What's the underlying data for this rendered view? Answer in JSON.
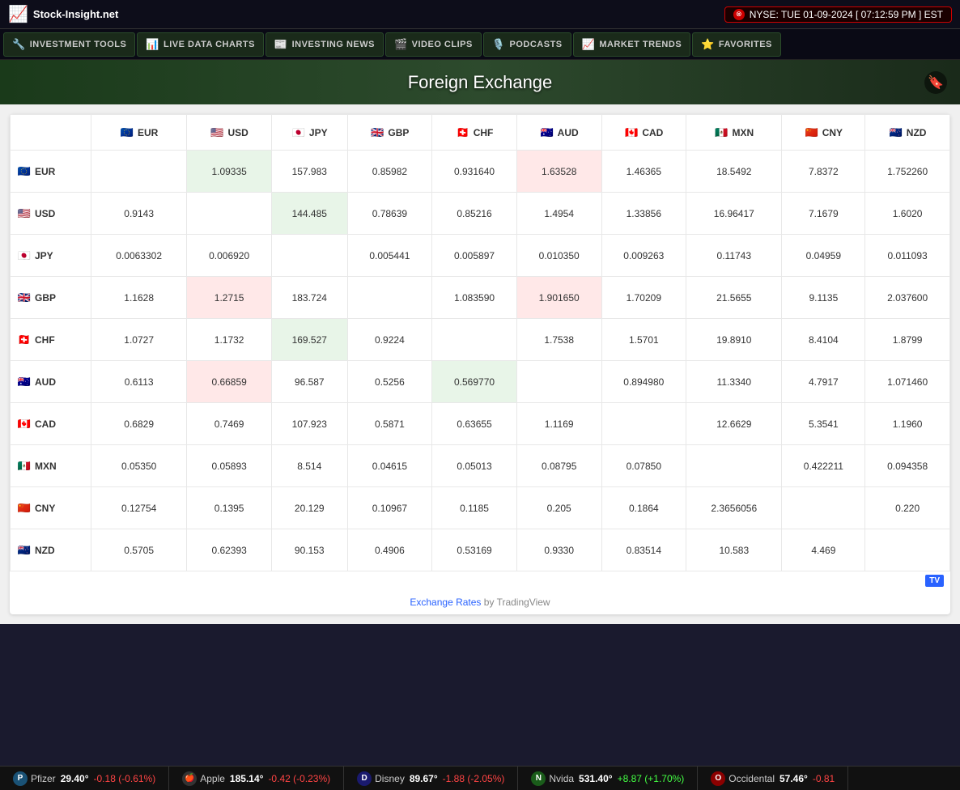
{
  "topbar": {
    "logo_icon": "📈",
    "logo_text": "Stock-Insight.net",
    "ticker_info": "NYSE: TUE 01-09-2024  [ 07:12:59 PM ] EST"
  },
  "nav": {
    "items": [
      {
        "id": "investment-tools",
        "label": "INVESTMENT TOOLS",
        "icon": "🔧"
      },
      {
        "id": "live-data-charts",
        "label": "LIVE DATA CHARTS",
        "icon": "📊"
      },
      {
        "id": "investing-news",
        "label": "INVESTING NEWS",
        "icon": "📰"
      },
      {
        "id": "video-clips",
        "label": "VIDEO CLIPS",
        "icon": "🎬"
      },
      {
        "id": "podcasts",
        "label": "PODCASTS",
        "icon": "🎙️"
      },
      {
        "id": "market-trends",
        "label": "MARKET TRENDS",
        "icon": "📈"
      },
      {
        "id": "favorites",
        "label": "FAVORITES",
        "icon": "⭐"
      }
    ]
  },
  "hero": {
    "title": "Foreign Exchange"
  },
  "table": {
    "columns": [
      "EUR",
      "USD",
      "JPY",
      "GBP",
      "CHF",
      "AUD",
      "CAD",
      "MXN",
      "CNY",
      "NZD"
    ],
    "column_flags": [
      "🇪🇺",
      "🇺🇸",
      "🇯🇵",
      "🇬🇧",
      "🇨🇭",
      "🇦🇺",
      "🇨🇦",
      "🇲🇽",
      "🇨🇳",
      "🇳🇿"
    ],
    "rows": [
      {
        "currency": "EUR",
        "flag": "🇪🇺",
        "values": [
          "",
          "1.09335",
          "157.983",
          "0.85982",
          "0.931640",
          "1.63528",
          "1.46365",
          "18.5492",
          "7.8372",
          "1.752260"
        ],
        "highlights": [
          0,
          1,
          0,
          0,
          0,
          2,
          0,
          0,
          0,
          0
        ]
      },
      {
        "currency": "USD",
        "flag": "🇺🇸",
        "values": [
          "0.9143",
          "",
          "144.485",
          "0.78639",
          "0.85216",
          "1.4954",
          "1.33856",
          "16.96417",
          "7.1679",
          "1.6020"
        ],
        "highlights": [
          0,
          0,
          1,
          0,
          0,
          0,
          0,
          0,
          0,
          0
        ]
      },
      {
        "currency": "JPY",
        "flag": "🇯🇵",
        "values": [
          "0.0063302",
          "0.006920",
          "",
          "0.005441",
          "0.005897",
          "0.010350",
          "0.009263",
          "0.11743",
          "0.04959",
          "0.011093"
        ],
        "highlights": [
          0,
          0,
          0,
          0,
          0,
          0,
          0,
          0,
          0,
          0
        ]
      },
      {
        "currency": "GBP",
        "flag": "🇬🇧",
        "values": [
          "1.1628",
          "1.2715",
          "183.724",
          "",
          "1.083590",
          "1.901650",
          "1.70209",
          "21.5655",
          "9.1135",
          "2.037600"
        ],
        "highlights": [
          0,
          2,
          0,
          0,
          0,
          2,
          0,
          0,
          0,
          0
        ]
      },
      {
        "currency": "CHF",
        "flag": "🇨🇭",
        "values": [
          "1.0727",
          "1.1732",
          "169.527",
          "0.9224",
          "",
          "1.7538",
          "1.5701",
          "19.8910",
          "8.4104",
          "1.8799"
        ],
        "highlights": [
          0,
          0,
          1,
          0,
          0,
          0,
          0,
          0,
          0,
          0
        ]
      },
      {
        "currency": "AUD",
        "flag": "🇦🇺",
        "values": [
          "0.6113",
          "0.66859",
          "96.587",
          "0.5256",
          "0.569770",
          "",
          "0.894980",
          "11.3340",
          "4.7917",
          "1.071460"
        ],
        "highlights": [
          0,
          2,
          0,
          0,
          1,
          0,
          0,
          0,
          0,
          0
        ]
      },
      {
        "currency": "CAD",
        "flag": "🇨🇦",
        "values": [
          "0.6829",
          "0.7469",
          "107.923",
          "0.5871",
          "0.63655",
          "1.1169",
          "",
          "12.6629",
          "5.3541",
          "1.1960"
        ],
        "highlights": [
          0,
          0,
          0,
          0,
          0,
          0,
          0,
          0,
          0,
          0
        ]
      },
      {
        "currency": "MXN",
        "flag": "🇲🇽",
        "values": [
          "0.05350",
          "0.05893",
          "8.514",
          "0.04615",
          "0.05013",
          "0.08795",
          "0.07850",
          "",
          "0.422211",
          "0.094358"
        ],
        "highlights": [
          0,
          0,
          0,
          0,
          0,
          0,
          0,
          0,
          0,
          0
        ]
      },
      {
        "currency": "CNY",
        "flag": "🇨🇳",
        "values": [
          "0.12754",
          "0.1395",
          "20.129",
          "0.10967",
          "0.1185",
          "0.205",
          "0.1864",
          "2.3656056",
          "",
          "0.220"
        ],
        "highlights": [
          0,
          0,
          0,
          0,
          0,
          0,
          0,
          0,
          0,
          0
        ]
      },
      {
        "currency": "NZD",
        "flag": "🇳🇿",
        "values": [
          "0.5705",
          "0.62393",
          "90.153",
          "0.4906",
          "0.53169",
          "0.9330",
          "0.83514",
          "10.583",
          "4.469",
          ""
        ],
        "highlights": [
          0,
          0,
          0,
          0,
          0,
          0,
          0,
          0,
          0,
          0
        ]
      }
    ]
  },
  "footer": {
    "exchange_rates_label": "Exchange Rates",
    "by_label": " by TradingView"
  },
  "ticker_tape": {
    "items": [
      {
        "logo_color": "#1a5276",
        "logo_text": "P",
        "name": "Pfizer",
        "price": "29.40°",
        "change": "-0.18 (-0.61%)",
        "positive": false
      },
      {
        "logo_color": "#333",
        "logo_text": "🍎",
        "name": "Apple",
        "price": "185.14°",
        "change": "-0.42 (-0.23%)",
        "positive": false
      },
      {
        "logo_color": "#1a1a6e",
        "logo_text": "D",
        "name": "Disney",
        "price": "89.67°",
        "change": "-1.88 (-2.05%)",
        "positive": false
      },
      {
        "logo_color": "#1a5c1a",
        "logo_text": "N",
        "name": "Nvida",
        "price": "531.40°",
        "change": "+8.87 (+1.70%)",
        "positive": true
      },
      {
        "logo_color": "#8B0000",
        "logo_text": "O",
        "name": "Occidental",
        "price": "57.46°",
        "change": "-0.81",
        "positive": false
      }
    ]
  }
}
